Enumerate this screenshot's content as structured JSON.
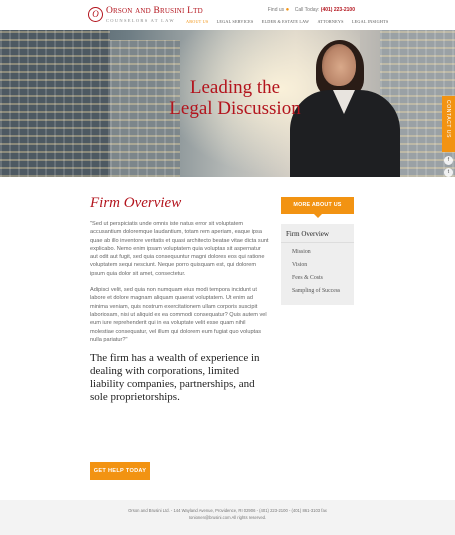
{
  "header": {
    "logo_mark": "O",
    "logo_name": "Orson and Brusini Ltd",
    "logo_sub": "COUNSELORS AT LAW",
    "find_us": "Find us",
    "call_today": "Call Today:",
    "phone": "(401) 223-2100",
    "nav": [
      {
        "label": "ABOUT US",
        "active": true
      },
      {
        "label": "LEGAL SERVICES",
        "active": false
      },
      {
        "label": "ELDER & ESTATE LAW",
        "active": false
      },
      {
        "label": "ATTORNEYS",
        "active": false
      },
      {
        "label": "LEGAL INSIGHTS",
        "active": false
      }
    ]
  },
  "hero": {
    "title_line1": "Leading the",
    "title_line2": "Legal Discussion",
    "contact_tab": "CONTACT US"
  },
  "main": {
    "heading": "Firm Overview",
    "para1": "\"Sed ut perspiciatis unde omnis iste natus error sit voluptatem accusantium doloremque laudantium, totam rem aperiam, eaque ipsa quae ab illo inventore veritatis et quasi architecto beatae vitae dicta sunt explicabo. Nemo enim ipsam voluptatem quia voluptas sit aspernatur aut odit aut fugit, sed quia consequuntur magni dolores eos qui ratione voluptatem sequi nesciunt. Neque porro quisquam est, qui dolorem ipsum quia dolor sit amet, consectetur.",
    "para2": "Adipisci velit, sed quia non numquam eius modi tempora incidunt ut labore et dolore magnam aliquam quaerat voluptatem. Ut enim ad minima veniam, quis nostrum exercitationem ullam corporis suscipit laboriosam, nisi ut aliquid ex ea commodi consequatur? Quis autem vel eum iure reprehenderit qui in ea voluptate velit esse quam nihil molestiae consequatur, vel illum qui dolorem eum fugiat quo voluptas nulla pariatur?\"",
    "quote": "The firm has a wealth of experience in dealing with corporations, limited liability companies, partnerships, and sole proprietorships.",
    "cta": "GET HELP TODAY"
  },
  "sidebar": {
    "button": "MORE ABOUT US",
    "box_title": "Firm Overview",
    "items": [
      "Mission",
      "Vision",
      "Fees & Costs",
      "Sampling of Success"
    ]
  },
  "footer": {
    "line1": "Orson and Brusini Ltd. - 144 Wayland Avenue, Providence, RI 02906 - (401) 223-2100 - (401) 861-3103 fax",
    "line2": "Ionionen@brusini.com All rights reserved."
  },
  "colors": {
    "brand_red": "#b3141d",
    "accent_orange": "#f29312"
  }
}
